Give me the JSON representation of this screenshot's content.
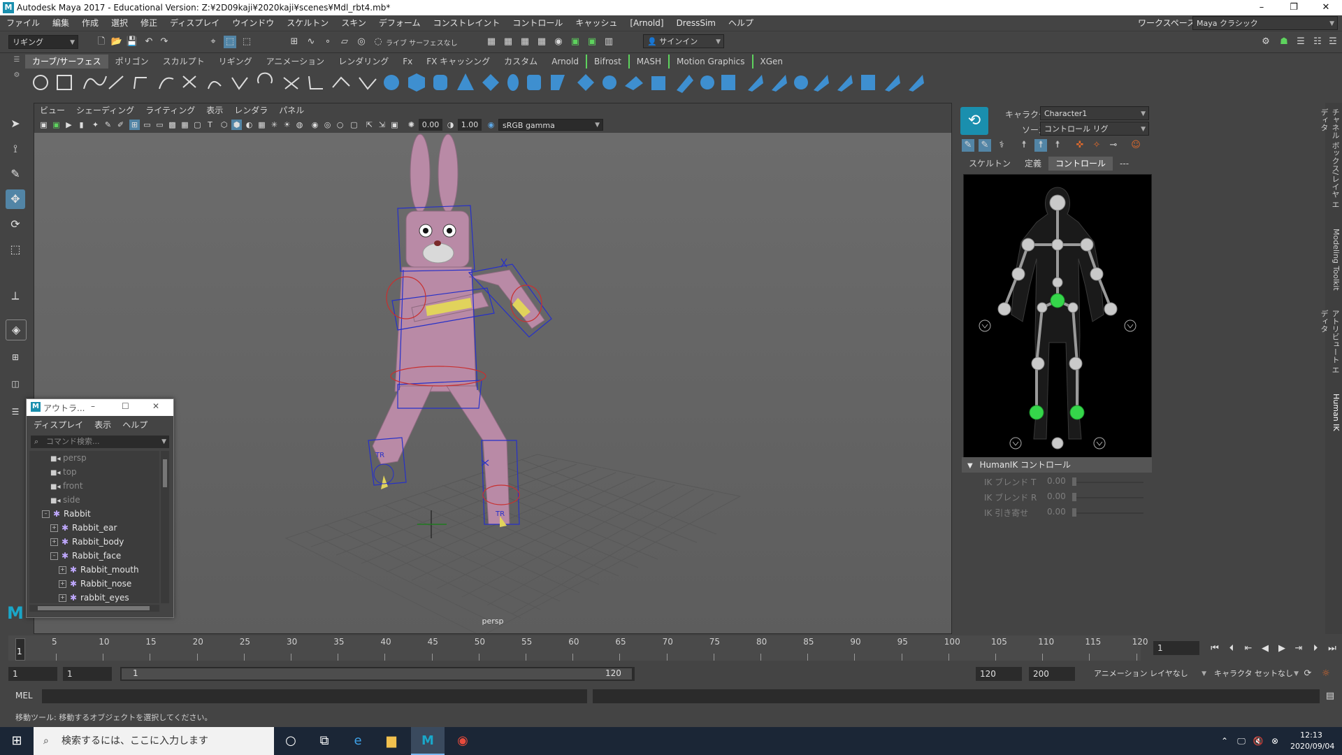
{
  "window": {
    "logo": "M",
    "title": "Autodesk Maya 2017 - Educational Version: Z:¥2D09kaji¥2020kaji¥scenes¥Mdl_rbt4.mb*",
    "minimize": "–",
    "restore": "❐",
    "close": "✕"
  },
  "menubar": {
    "items": [
      "ファイル",
      "編集",
      "作成",
      "選択",
      "修正",
      "ディスプレイ",
      "ウインドウ",
      "スケルトン",
      "スキン",
      "デフォーム",
      "コンストレイント",
      "コントロール",
      "キャッシュ"
    ],
    "arnold": "[Arnold]",
    "extra": [
      "DressSim",
      "ヘルプ"
    ],
    "workspace_label": "ワークスペース:",
    "workspace_value": "Maya クラシック"
  },
  "statusline": {
    "mode": "リギング",
    "live_surface": "ライブ サーフェスなし",
    "signin": "サインイン"
  },
  "shelf": {
    "tabs": [
      "カーブ/サーフェス",
      "ポリゴン",
      "スカルプト",
      "リギング",
      "アニメーション",
      "レンダリング",
      "Fx",
      "FX キャッシング",
      "カスタム",
      "Arnold",
      "Bifrost",
      "MASH",
      "Motion Graphics",
      "XGen"
    ],
    "active": 0
  },
  "viewport": {
    "menu": [
      "ビュー",
      "シェーディング",
      "ライティング",
      "表示",
      "レンダラ",
      "パネル"
    ],
    "exposure": "0.00",
    "gamma": "1.00",
    "colorspace": "sRGB gamma",
    "camera_label": "persp",
    "tr_labels": [
      "TR",
      "TR"
    ]
  },
  "outliner": {
    "logo": "M",
    "title": "アウトラ...",
    "menu": [
      "ディスプレイ",
      "表示",
      "ヘルプ"
    ],
    "search_placeholder": "コマンド検索...",
    "items": [
      {
        "label": "persp",
        "kind": "camera"
      },
      {
        "label": "top",
        "kind": "camera"
      },
      {
        "label": "front",
        "kind": "camera"
      },
      {
        "label": "side",
        "kind": "camera"
      },
      {
        "label": "Rabbit",
        "kind": "group",
        "expander": "–"
      },
      {
        "label": "Rabbit_ear",
        "kind": "group",
        "expander": "+"
      },
      {
        "label": "Rabbit_body",
        "kind": "group",
        "expander": "+"
      },
      {
        "label": "Rabbit_face",
        "kind": "group",
        "expander": "–"
      },
      {
        "label": "Rabbit_mouth",
        "kind": "group",
        "expander": "+"
      },
      {
        "label": "Rabbit_nose",
        "kind": "group",
        "expander": "+"
      },
      {
        "label": "rabbit_eyes",
        "kind": "group",
        "expander": "+"
      }
    ]
  },
  "humanik": {
    "character_label": "キャラクタ:",
    "character_value": "Character1",
    "source_label": "ソース:",
    "source_value": "コントロール リグ",
    "tabs": [
      "スケルトン",
      "定義",
      "コントロール",
      "---"
    ],
    "active_tab": 2,
    "section_title": "HumanIK コントロール",
    "params": [
      {
        "label": "IK ブレンド T",
        "value": "0.00"
      },
      {
        "label": "IK ブレンド R",
        "value": "0.00"
      },
      {
        "label": "IK 引き寄せ",
        "value": "0.00"
      }
    ]
  },
  "side_tabs": [
    "チャネル ボックス/レイヤ エディタ",
    "Modeling Toolkit",
    "アトリビュート エディタ",
    "Human IK"
  ],
  "timeline": {
    "ticks": [
      "5",
      "10",
      "15",
      "20",
      "25",
      "30",
      "35",
      "40",
      "45",
      "50",
      "55",
      "60",
      "65",
      "70",
      "75",
      "80",
      "85",
      "90",
      "95",
      "100",
      "105",
      "110",
      "115",
      "120"
    ],
    "current_frame": "1",
    "frame_field": "1"
  },
  "range": {
    "start": "1",
    "range_start": "1",
    "slider_start": "1",
    "slider_end": "120",
    "range_end": "120",
    "end": "200",
    "anim_layer": "アニメーション レイヤなし",
    "char_set": "キャラクタ セットなし"
  },
  "cmdline": {
    "lang": "MEL"
  },
  "helpline": {
    "text": "移動ツール: 移動するオブジェクトを選択してください。"
  },
  "taskbar": {
    "search_placeholder": "検索するには、ここに入力します",
    "time": "12:13",
    "date": "2020/09/04"
  },
  "colors": {
    "accent": "#5ed35e",
    "maya_blue": "#1a8fae",
    "rabbit_pink": "#b98aa6",
    "cage_blue": "#2630c8",
    "hik_green": "#35d64a"
  }
}
